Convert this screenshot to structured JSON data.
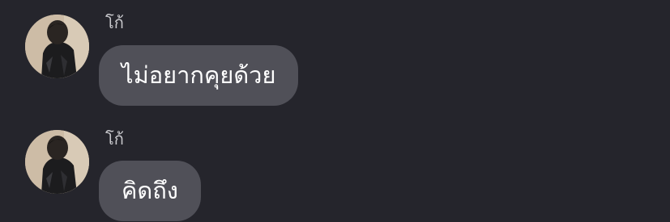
{
  "messages": [
    {
      "sender": "โก้",
      "text": "ไม่อยากคุยด้วย"
    },
    {
      "sender": "โก้",
      "text": "คิดถึง"
    }
  ],
  "colors": {
    "background": "#25252c",
    "bubble": "#505058",
    "bubble_text": "#ffffff",
    "sender_text": "#c8c8cc"
  }
}
